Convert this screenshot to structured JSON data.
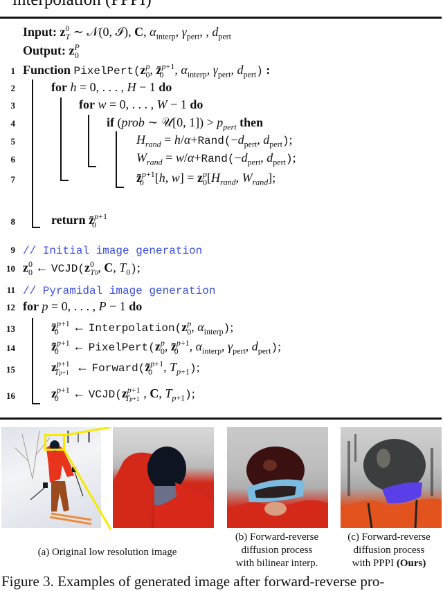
{
  "heading": "interpolation (PPPI)",
  "algorithm": {
    "input_label": "Input:",
    "input_expr": "z_T^0 ∼ 𝒩(0, ℐ), C, α_interp, γ_pert, , d_pert",
    "output_label": "Output:",
    "output_expr": "z_0^P",
    "lines": [
      {
        "n": "1",
        "text": "Function PixelPert(z_0^p, z̄_0^{p+1}, α_interp, γ_pert, d_pert):"
      },
      {
        "n": "2",
        "text": "for h = 0, . . . , H − 1 do"
      },
      {
        "n": "3",
        "text": "for w = 0, . . . , W − 1 do"
      },
      {
        "n": "4",
        "text": "if (prob ∼ 𝒰[0, 1]) > p_pert then"
      },
      {
        "n": "5",
        "text": "H_rand = h/α+Rand(−d_pert, d_pert);"
      },
      {
        "n": "6",
        "text": "W_rand = w/α+Rand(−d_pert, d_pert);"
      },
      {
        "n": "7",
        "text": "z̄_0^{p+1}[h, w] = z_0^p[H_rand, W_rand];"
      },
      {
        "n": "8",
        "text": "return z̄_0^{p+1}"
      },
      {
        "n": "9",
        "text": "// Initial image generation"
      },
      {
        "n": "10",
        "text": "z_0^0 ← VCJD(z_{T0}^0, C, T_0);"
      },
      {
        "n": "11",
        "text": "// Pyramidal image generation"
      },
      {
        "n": "12",
        "text": "for p = 0, . . . , P − 1 do"
      },
      {
        "n": "13",
        "text": "z̄_0^{p+1} ← Interpolation(z_0^p, α_interp);"
      },
      {
        "n": "14",
        "text": "z̃_0^{p+1} ← PixelPert(z_0^p, z̄_0^{p+1}, α_interp, γ_pert, d_pert);"
      },
      {
        "n": "15",
        "text": "z_{T_{p+1}}^{p+1} ← Forward(z̃_0^{p+1}, T_{p+1});"
      },
      {
        "n": "16",
        "text": "z_0^{p+1} ← VCJD(z_{T_{p+1}}^{p+1}, C, T_{p+1});"
      }
    ],
    "keywords": {
      "function": "Function",
      "for": "for",
      "do": "do",
      "if": "if",
      "then": "then",
      "return": "return"
    },
    "code_tokens": {
      "pixelpert": "PixelPert",
      "rand": "Rand",
      "vcjd": "VCJD",
      "interpolation": "Interpolation",
      "forward": "Forward",
      "comment1": "// Initial image generation",
      "comment2": "// Pyramidal image generation"
    },
    "comment_color": "#3b4fd8"
  },
  "figure": {
    "panels": [
      {
        "id": "a",
        "caption": "(a) Original low resolution image"
      },
      {
        "id": "b",
        "caption_lines": [
          "(b) Forward-reverse",
          "diffusion process",
          "with bilinear interp."
        ]
      },
      {
        "id": "c",
        "caption_lines": [
          "(c) Forward-reverse",
          "diffusion process",
          "with PPPI"
        ],
        "caption_bold": "(Ours)"
      }
    ],
    "highlight_color": "#f5ea00",
    "caption": "Figure 3. Examples of generated image after forward-reverse pro-"
  }
}
